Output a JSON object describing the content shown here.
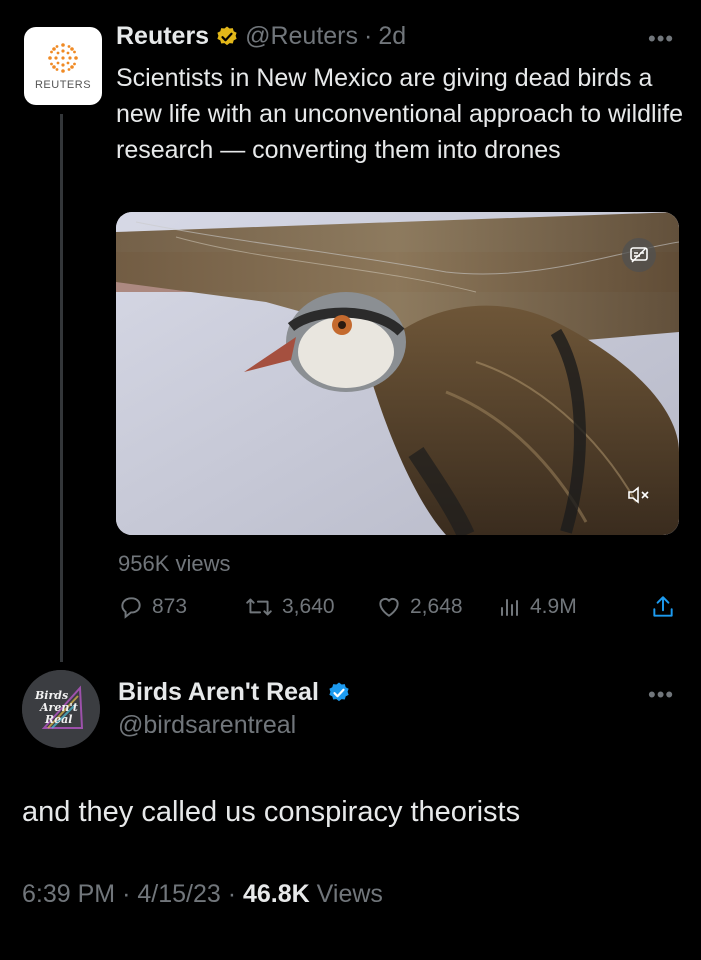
{
  "tweet1": {
    "avatar_text": "REUTERS",
    "display_name": "Reuters",
    "handle": "@Reuters",
    "separator": "·",
    "time": "2d",
    "text": "Scientists in New Mexico are giving dead birds a new life with an unconventional approach to wildlife research — converting them into drones",
    "views_label": "956K views",
    "stats": {
      "replies": "873",
      "retweets": "3,640",
      "likes": "2,648",
      "views": "4.9M"
    },
    "verified_badge_color": "#e2b719"
  },
  "tweet2": {
    "avatar_text": [
      "Birds",
      "Aren't",
      "Real"
    ],
    "display_name": "Birds Aren't Real",
    "handle": "@birdsarentreal",
    "text": "and they called us conspiracy theorists",
    "time": "6:39 PM",
    "date": "4/15/23",
    "separator": "·",
    "views_count": "46.8K",
    "views_word": "Views",
    "verified_badge_color": "#1d9bf0"
  },
  "colors": {
    "background": "#000000",
    "text": "#e7e9ea",
    "muted": "#71767b"
  },
  "icons": [
    "more-icon",
    "verified-gold-icon",
    "verified-blue-icon",
    "captions-icon",
    "mute-icon",
    "reply-icon",
    "retweet-icon",
    "like-icon",
    "analytics-icon",
    "share-icon"
  ]
}
